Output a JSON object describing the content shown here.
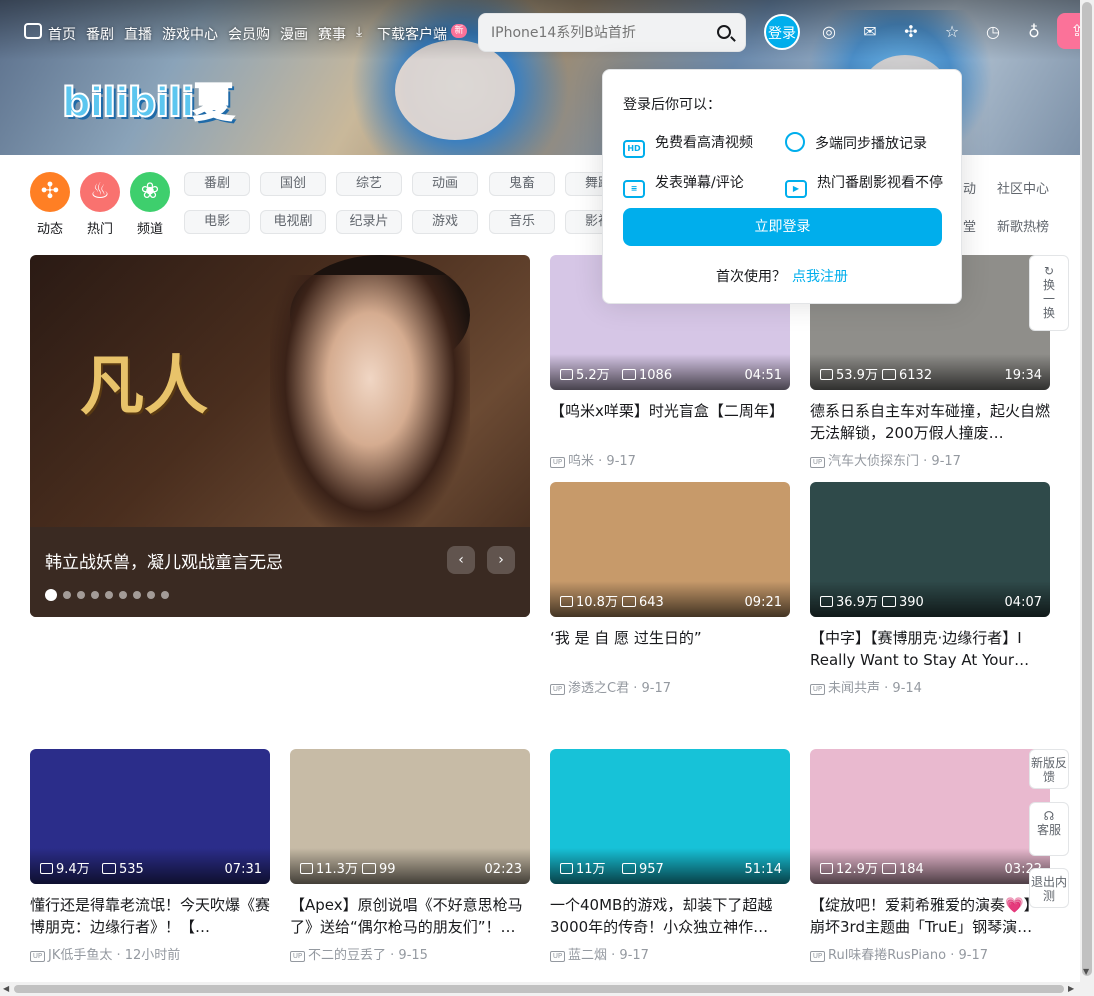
{
  "topnav": {
    "items": [
      "首页",
      "番剧",
      "直播",
      "游戏中心",
      "会员购",
      "漫画",
      "赛事",
      "下载客户端"
    ],
    "new_badge": "新",
    "search_placeholder": "IPhone14系列B站首折",
    "login": "登录"
  },
  "banner": {
    "logo": "bilibili夏"
  },
  "channels": [
    {
      "label": "动态",
      "color": "#ff7f24",
      "icon": "compass-icon"
    },
    {
      "label": "热门",
      "color": "#f9726f",
      "icon": "fire-icon"
    },
    {
      "label": "频道",
      "color": "#3ecf6d",
      "icon": "channel-icon"
    }
  ],
  "tags_row1": [
    "番剧",
    "国创",
    "综艺",
    "动画",
    "鬼畜",
    "舞蹈"
  ],
  "tags_row2": [
    "电影",
    "电视剧",
    "纪录片",
    "游戏",
    "音乐",
    "影视"
  ],
  "right_links": {
    "r1a": "动",
    "r1b": "社区中心",
    "r2a": "堂",
    "r2b": "新歌热榜"
  },
  "carousel": {
    "art_title": "凡人",
    "caption": "韩立战妖兽，凝儿观战童言无忌",
    "dots": 9,
    "active_dot": 0
  },
  "videos": [
    {
      "views": "5.2万",
      "danmaku": "1086",
      "duration": "04:51",
      "title": "【呜米x咩栗】时光盲盒【二周年】",
      "author": "呜米",
      "date": "9-17",
      "thumb": "#d6c6e6"
    },
    {
      "views": "53.9万",
      "danmaku": "6132",
      "duration": "19:34",
      "title": "德系日系自主车对车碰撞，起火自燃无法解锁，200万假人撞废…",
      "author": "汽车大侦探东门",
      "date": "9-17",
      "thumb": "#8f8e8a"
    },
    {
      "views": "10.8万",
      "danmaku": "643",
      "duration": "09:21",
      "title": "‘我 是 自 愿 过生日的”",
      "author": "渗透之C君",
      "date": "9-17",
      "thumb": "#c79a6a"
    },
    {
      "views": "36.9万",
      "danmaku": "390",
      "duration": "04:07",
      "title": "【中字】【赛博朋克·边缘行者】I Really Want to Stay At Your Ho…",
      "author": "未闻共声",
      "date": "9-14",
      "thumb": "#2f4a4a"
    },
    {
      "views": "9.4万",
      "danmaku": "535",
      "duration": "07:31",
      "title": "懂行还是得靠老流氓！今天吹爆《赛博朋克：边缘行者》！【…",
      "author": "JK低手鱼太",
      "date": "12小时前",
      "thumb": "#2b2d8a"
    },
    {
      "views": "11.3万",
      "danmaku": "99",
      "duration": "02:23",
      "title": "【Apex】原创说唱《不好意思枪马了》送给“偶尔枪马的朋友们”！…",
      "author": "不二的豆丢了",
      "date": "9-15",
      "thumb": "#c7bba6"
    },
    {
      "views": "11万",
      "danmaku": "957",
      "duration": "51:14",
      "title": "一个40MB的游戏，却装下了超越3000年的传奇！小众独立神作…",
      "author": "蓝二烟",
      "date": "9-17",
      "thumb": "#17c2d8"
    },
    {
      "views": "12.9万",
      "danmaku": "184",
      "duration": "03:22",
      "title": "【绽放吧！爱莉希雅爱的演奏💗】崩坏3rd主题曲「TruE」钢琴演…",
      "author": "Rul味春捲RusPiano",
      "date": "9-17",
      "thumb": "#e9b9cf"
    }
  ],
  "side": {
    "refresh": "换一换",
    "feedback": "新版反馈",
    "service": "客服",
    "exit": "退出内测"
  },
  "popover": {
    "title": "登录后你可以：",
    "benefits": [
      "免费看高清视频",
      "多端同步播放记录",
      "发表弹幕/评论",
      "热门番剧影视看不停"
    ],
    "hd_label": "HD",
    "button": "立即登录",
    "first_use": "首次使用？",
    "register": "点我注册"
  }
}
